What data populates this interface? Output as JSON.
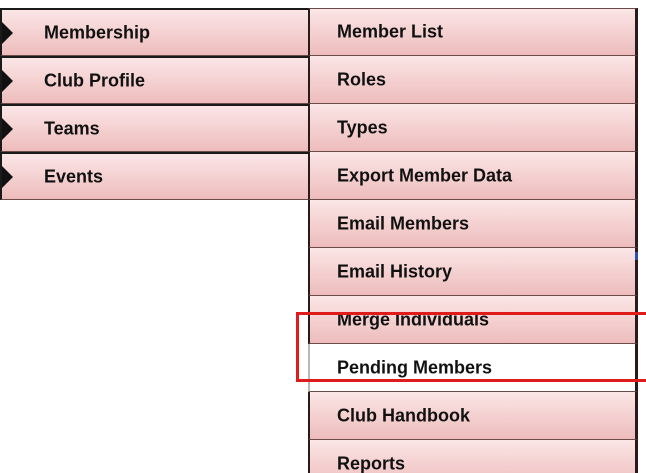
{
  "left_menu": {
    "items": [
      {
        "label": "Membership"
      },
      {
        "label": "Club Profile"
      },
      {
        "label": "Teams"
      },
      {
        "label": "Events"
      }
    ]
  },
  "sub_menu": {
    "items": [
      {
        "label": "Member List"
      },
      {
        "label": "Roles"
      },
      {
        "label": "Types"
      },
      {
        "label": "Export Member Data"
      },
      {
        "label": "Email Members"
      },
      {
        "label": "Email History"
      },
      {
        "label": "Merge Individuals"
      },
      {
        "label": "Pending Members"
      },
      {
        "label": "Club Handbook"
      },
      {
        "label": "Reports"
      }
    ],
    "selected": "Pending Members"
  },
  "colors": {
    "menu_bg_top": "#fbe6e6",
    "menu_bg_bottom": "#edbcbc",
    "selected_bg": "#ffffff",
    "highlight": "#e01b1b",
    "text": "#111111"
  }
}
